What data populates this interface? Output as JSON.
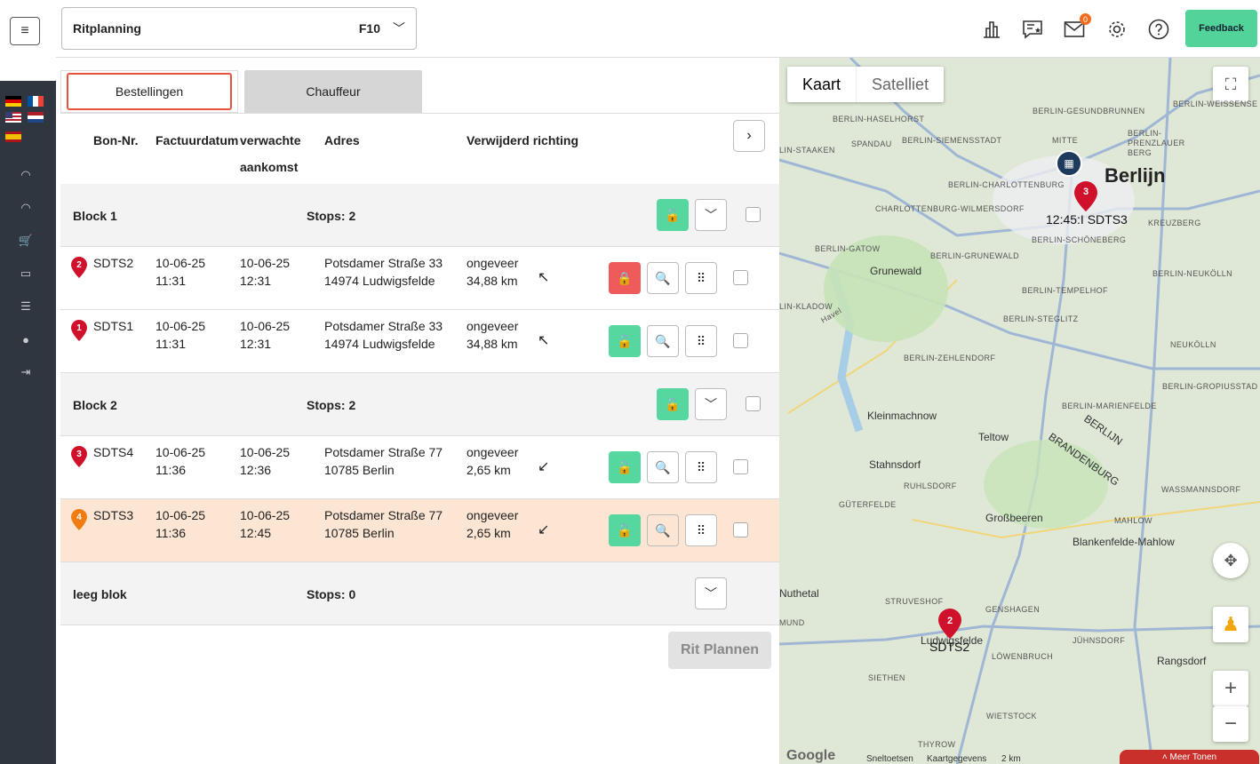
{
  "header": {
    "selector_label": "Ritplanning",
    "selector_value": "F10",
    "notification_count": "0",
    "feedback_label": "Feedback"
  },
  "tabs": [
    {
      "label": "Bestellingen"
    },
    {
      "label": "Chauffeur"
    }
  ],
  "columns": {
    "bon": "Bon-Nr.",
    "factuur": "Factuurdatum",
    "verwachte": "verwachte",
    "aankomst": "aankomst",
    "adres": "Adres",
    "verwijderd": "Verwijderd richting"
  },
  "blocks": [
    {
      "name": "Block 1",
      "stops": "Stops: 2"
    },
    {
      "name": "Block 2",
      "stops": "Stops: 2"
    },
    {
      "name": "leeg blok",
      "stops": "Stops: 0"
    }
  ],
  "orders": [
    {
      "pin": "2",
      "bon": "SDTS2",
      "fdate": "10-06-25",
      "ftime": "11:31",
      "adate": "10-06-25",
      "atime": "12:31",
      "street": "Potsdamer Straße 33",
      "city": "14974 Ludwigsfelde",
      "dist1": "ongeveer",
      "dist2": "34,88 km",
      "arrow": "↖"
    },
    {
      "pin": "1",
      "bon": "SDTS1",
      "fdate": "10-06-25",
      "ftime": "11:31",
      "adate": "10-06-25",
      "atime": "12:31",
      "street": "Potsdamer Straße 33",
      "city": "14974 Ludwigsfelde",
      "dist1": "ongeveer",
      "dist2": "34,88 km",
      "arrow": "↖"
    },
    {
      "pin": "3",
      "bon": "SDTS4",
      "fdate": "10-06-25",
      "ftime": "11:36",
      "adate": "10-06-25",
      "atime": "12:36",
      "street": "Potsdamer Straße 77",
      "city": "10785 Berlin",
      "dist1": "ongeveer",
      "dist2": "2,65 km",
      "arrow": "↙"
    },
    {
      "pin": "4",
      "bon": "SDTS3",
      "fdate": "10-06-25",
      "ftime": "11:36",
      "adate": "10-06-25",
      "atime": "12:45",
      "street": "Potsdamer Straße 77",
      "city": "10785 Berlin",
      "dist1": "ongeveer",
      "dist2": "2,65 km",
      "arrow": "↙"
    }
  ],
  "plan_button": "Rit Plannen",
  "map": {
    "type_map": "Kaart",
    "type_sat": "Satelliet",
    "city": "Berlijn",
    "marker_top_num": "3",
    "marker_top_label": "12:45:I SDTS3",
    "marker_bottom_num": "2",
    "marker_bottom_label": "SDTS2",
    "labels": {
      "haselhorst": "BERLIN-HASELHORST",
      "gesundbrunnen": "BERLIN-GESUNDBRUNNEN",
      "weissensee": "BERLIN-WEISSENSE",
      "spandau": "SPANDAU",
      "siemensstadt": "BERLIN-SIEMENSSTADT",
      "mitte": "MITTE",
      "prenzlauer": "BERLIN-PRENZLAUER BERG",
      "staaken": "LIN-STAAKEN",
      "charlottenburg": "BERLIN-CHARLOTTENBURG",
      "charlwilm": "CHARLOTTENBURG-WILMERSDORF",
      "kreuzberg": "KREUZBERG",
      "schoeneberg": "BERLIN-SCHÖNEBERG",
      "gatow": "BERLIN-GATOW",
      "grunewald": "Grunewald",
      "berlingrunewald": "BERLIN-GRUNEWALD",
      "neukoelln": "BERLIN-NEUKÖLLN",
      "tempelhof": "BERLIN-TEMPELHOF",
      "kladow": "LIN-KLADOW",
      "steglitz": "BERLIN-STEGLITZ",
      "neukolln2": "NEUKÖLLN",
      "zehlendorf": "BERLIN-ZEHLENDORF",
      "gropiusstadt": "BERLIN-GROPIUSSTAD",
      "marienfelde": "BERLIN-MARIENFELDE",
      "kleinmachnow": "Kleinmachnow",
      "teltow": "Teltow",
      "berlijn2": "BERLIJN",
      "brandenburg": "BRANDENBURG",
      "stahnsdorf": "Stahnsdorf",
      "ruhlsdorf": "RUHLSDORF",
      "wassmannsdorf": "WASSMANNSDORF",
      "gueterfelde": "GÜTERFELDE",
      "grossbeeren": "Großbeeren",
      "mahlow": "MAHLOW",
      "blankenfelde": "Blankenfelde-Mahlow",
      "nuthetal": "Nuthetal",
      "struveshof": "STRUVESHOF",
      "genshagen": "GENSHAGEN",
      "juehnsdorf": "JÜHNSDORF",
      "loewenbruch": "LÖWENBRUCH",
      "rangsdorf": "Rangsdorf",
      "siethen": "SIETHEN",
      "wietstock": "WIETSTOCK",
      "thyrow": "THYROW",
      "ludwigsfelde": "Ludwigsfelde",
      "havel": "Havel",
      "mund": "MUND"
    },
    "attribution": {
      "shortcuts": "Sneltoetsen",
      "mapdata": "Kaartgegevens",
      "scale": "2 km",
      "more": "Meer Tonen",
      "google": "Google"
    }
  },
  "colors": {
    "accent_green": "#55d79f",
    "lock_red": "#ef5a5a",
    "tab_border": "#e8513c",
    "pin_red": "#d0112b",
    "pin_orange": "#f07d12",
    "highlight_row": "#fde5d3"
  }
}
